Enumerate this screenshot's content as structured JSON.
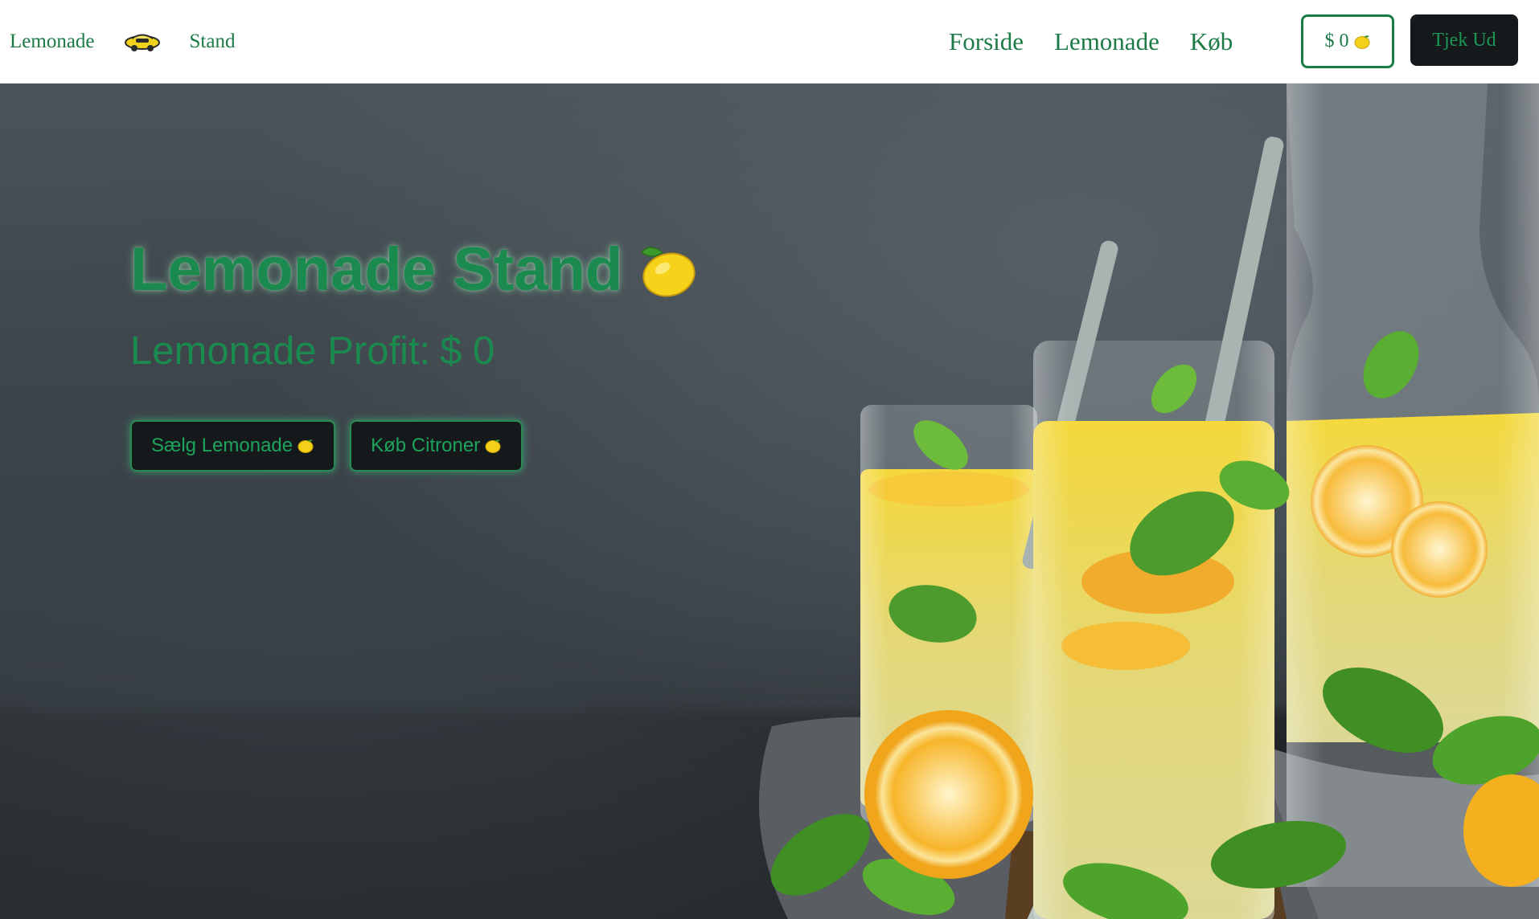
{
  "navbar": {
    "brand_left": "Lemonade",
    "brand_right": "Stand",
    "logo_icon": "lemon-car-logo-icon",
    "links": [
      {
        "label": "Forside"
      },
      {
        "label": "Lemonade"
      },
      {
        "label": "Køb"
      }
    ],
    "cart_label": "$ 0",
    "checkout_label": "Tjek Ud"
  },
  "hero": {
    "title": "Lemonade Stand",
    "profit_label": "Lemonade Profit:",
    "profit_value": "$ 0",
    "buttons": [
      {
        "label": "Sælg Lemonade",
        "icon": "lemon-icon"
      },
      {
        "label": "Køb Citroner",
        "icon": "lemon-icon"
      }
    ],
    "background_image": "lemonade-glasses-photo"
  },
  "colors": {
    "brand_green": "#1b7a45",
    "dark_button": "#15191c",
    "hero_text_green": "#1b8a4e"
  }
}
